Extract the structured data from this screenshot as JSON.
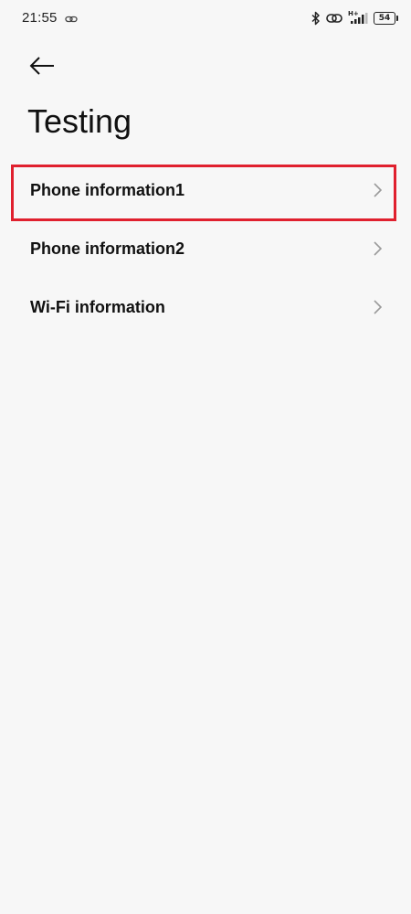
{
  "status_bar": {
    "time": "21:55",
    "network_type": "H+",
    "battery_level": "54",
    "icons": [
      "link-icon",
      "bluetooth-icon",
      "hotspot-link-icon",
      "signal-icon",
      "battery-icon"
    ]
  },
  "header": {
    "back_icon": "arrow-left-icon",
    "title": "Testing"
  },
  "list": {
    "items": [
      {
        "label": "Phone information1",
        "icon": "chevron-right-icon",
        "highlighted": true
      },
      {
        "label": "Phone information2",
        "icon": "chevron-right-icon",
        "highlighted": false
      },
      {
        "label": "Wi-Fi information",
        "icon": "chevron-right-icon",
        "highlighted": false
      }
    ]
  },
  "colors": {
    "background": "#f7f7f7",
    "text": "#111111",
    "chevron": "#9a9a9a",
    "highlight": "#e0202e"
  }
}
